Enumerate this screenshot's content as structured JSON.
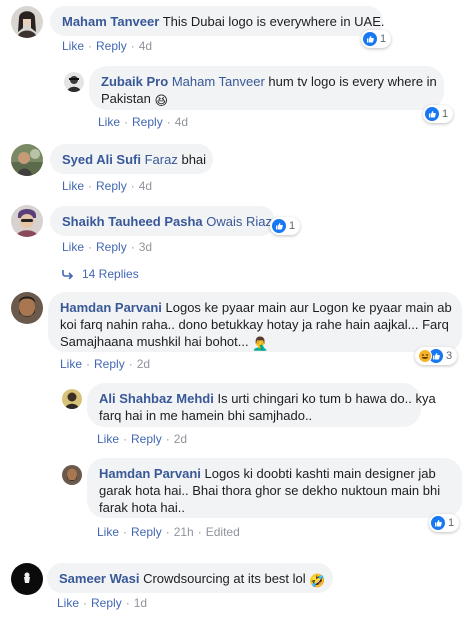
{
  "comments": [
    {
      "author": "Maham Tanveer",
      "text": "This Dubai logo is everywhere in UAE.",
      "like": "Like",
      "reply": "Reply",
      "time": "4d",
      "reactions": "1"
    },
    {
      "author": "Zubaik Pro",
      "mention": "Maham Tanveer",
      "text_line1": "hum tv logo is every where in",
      "text_line2": "Pakistan",
      "emoji": "😆",
      "like": "Like",
      "reply": "Reply",
      "time": "4d",
      "reactions": "1"
    },
    {
      "author": "Syed Ali Sufi",
      "mention": "Faraz",
      "text": "bhai",
      "like": "Like",
      "reply": "Reply",
      "time": "4d"
    },
    {
      "author": "Shaikh Tauheed Pasha",
      "mention": "Owais Riaz",
      "like": "Like",
      "reply": "Reply",
      "time": "3d",
      "reactions": "1",
      "replies_label": "14 Replies"
    },
    {
      "author": "Hamdan Parvani",
      "text_line1": "Logos ke pyaar main aur Logon ke pyaar main ab",
      "text_line2": "koi farq nahin raha.. dono betukkay hotay ja rahe hain aajkal... Farq",
      "text_line3": "Samajhaana mushkil hai bohot...",
      "emoji": "🤦‍♂️",
      "like": "Like",
      "reply": "Reply",
      "time": "2d",
      "reactions": "3"
    },
    {
      "author": "Ali Shahbaz Mehdi",
      "text_line1": "Is urti chingari ko tum b hawa do.. kya",
      "text_line2": "farq hai in me hamein bhi samjhado..",
      "like": "Like",
      "reply": "Reply",
      "time": "2d"
    },
    {
      "author": "Hamdan Parvani",
      "text_line1": "Logos ki doobti kashti main designer jab",
      "text_line2": "garak hota hai.. Bhai thora ghor se dekho nuktoun main bhi",
      "text_line3": "farak hota hai..",
      "like": "Like",
      "reply": "Reply",
      "time": "21h",
      "edited": "Edited",
      "reactions": "1"
    },
    {
      "author": "Sameer Wasi",
      "text": "Crowdsourcing at its best lol",
      "emoji": "🤣",
      "like": "Like",
      "reply": "Reply",
      "time": "1d"
    }
  ],
  "colors": {
    "link": "#385898",
    "meta_link": "#4267b2",
    "meta": "#90949c",
    "bubble": "#f2f3f5",
    "like": "#1877f2",
    "haha": "#f7b125"
  }
}
